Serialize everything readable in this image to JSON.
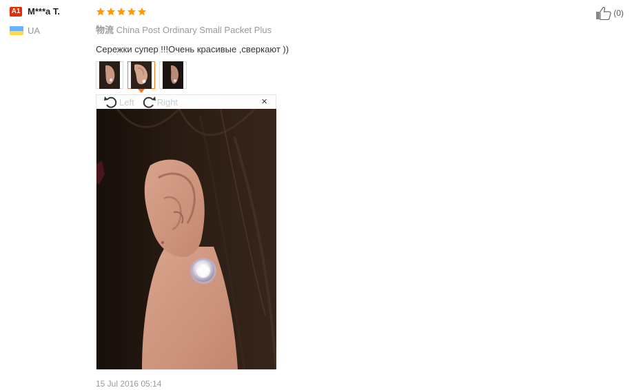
{
  "reviewer": {
    "level_badge": "A1",
    "name": "M***a T.",
    "country_code": "UA",
    "flag_icon": "ukraine-flag-icon",
    "badge_color": "#e62e04"
  },
  "review": {
    "rating": 5,
    "star_color": "#ff9a00",
    "logistics_label": "物流",
    "logistics_value": "China Post Ordinary Small Packet Plus",
    "text": "Сережки супер !!!Очень красивые ,сверкают ))",
    "date": "15 Jul 2016 05:14",
    "helpful_count": "(0)"
  },
  "thumbnails": [
    {
      "name": "ear-photo-1",
      "active": false
    },
    {
      "name": "ear-photo-2",
      "active": true
    },
    {
      "name": "ear-photo-3",
      "active": false
    }
  ],
  "viewer": {
    "rotate_left_label": "Left",
    "rotate_right_label": "Right",
    "close_symbol": "×",
    "accent_color": "#ff7519"
  }
}
